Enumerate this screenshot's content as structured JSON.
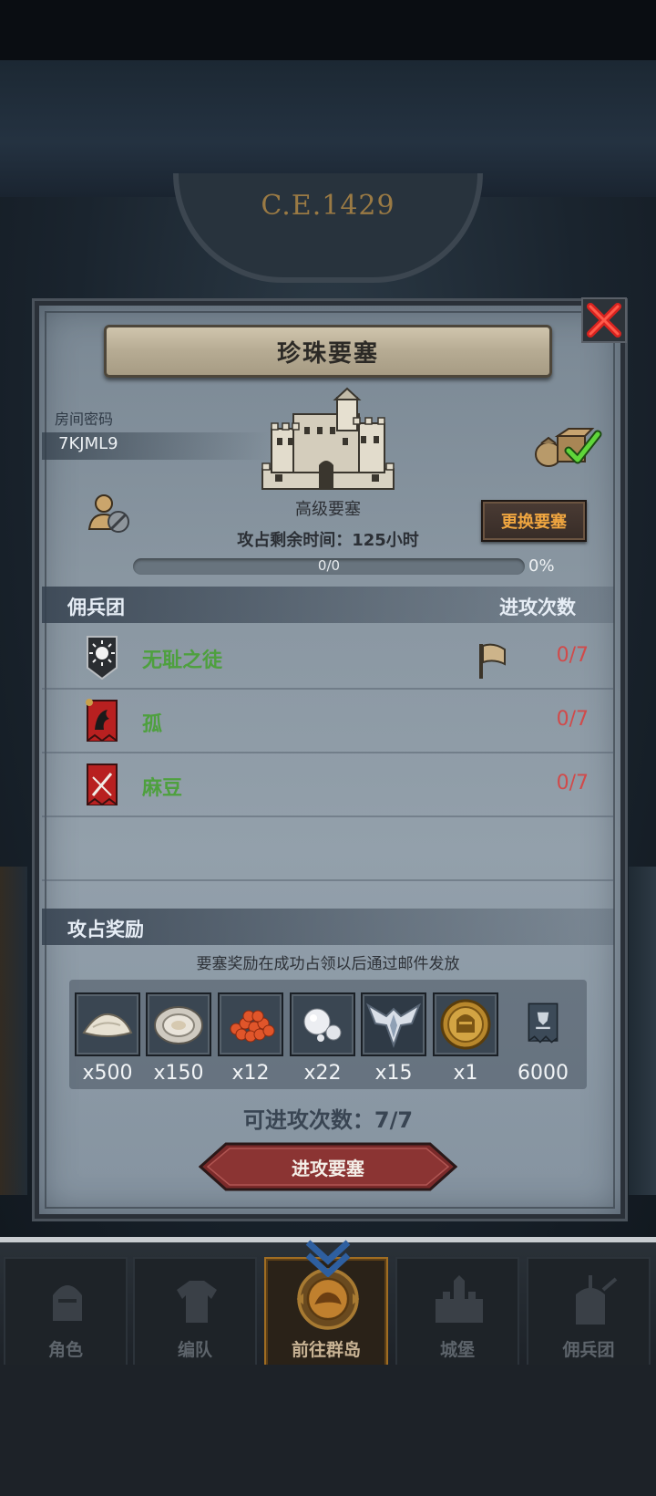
{
  "background": {
    "calendar_year": "C.E.1429"
  },
  "dialog": {
    "title": "珍珠要塞",
    "room_password_label": "房间密码",
    "room_password_value": "7KJML9",
    "fortress_type": "高级要塞",
    "change_button": "更换要塞",
    "time_remaining": "攻占剩余时间：125小时",
    "progress": {
      "text": "0/0",
      "percent_text": "0%",
      "fraction": 0
    },
    "mercenary_header": {
      "left": "佣兵团",
      "right": "进攻次数"
    },
    "mercenaries": [
      {
        "name": "无耻之徒",
        "count": "0/7",
        "color": "#4ea03e",
        "banner": "sun-banner"
      },
      {
        "name": "孤",
        "count": "0/7",
        "color": "#4ea03e",
        "banner": "beast-banner"
      },
      {
        "name": "麻豆",
        "count": "0/7",
        "color": "#4ea03e",
        "banner": "sword-banner"
      }
    ],
    "reward_header": "攻占奖励",
    "reward_note": "要塞奖励在成功占领以后通过邮件发放",
    "rewards": [
      {
        "icon": "salt-pile-icon",
        "qty": "x500"
      },
      {
        "icon": "oyster-icon",
        "qty": "x150"
      },
      {
        "icon": "fish-roe-icon",
        "qty": "x12"
      },
      {
        "icon": "pearl-icon",
        "qty": "x22"
      },
      {
        "icon": "winged-emblem-icon",
        "qty": "x15"
      },
      {
        "icon": "knight-coin-icon",
        "qty": "x1"
      },
      {
        "icon": "guild-banner-icon",
        "qty": "6000"
      }
    ],
    "attacks_available": "可进攻次数：7/7",
    "attack_button": "进攻要塞"
  },
  "nav": {
    "items": [
      {
        "label": "角色",
        "icon": "knight-helmet-icon"
      },
      {
        "label": "编队",
        "icon": "armor-icon"
      },
      {
        "label": "前往群岛",
        "icon": "compass-icon",
        "active": true
      },
      {
        "label": "城堡",
        "icon": "castle-icon"
      },
      {
        "label": "佣兵团",
        "icon": "mercenary-icon"
      }
    ]
  },
  "colors": {
    "accent_gold": "#f0a640",
    "count_red": "#d14a4a",
    "name_green": "#4ea03e"
  }
}
